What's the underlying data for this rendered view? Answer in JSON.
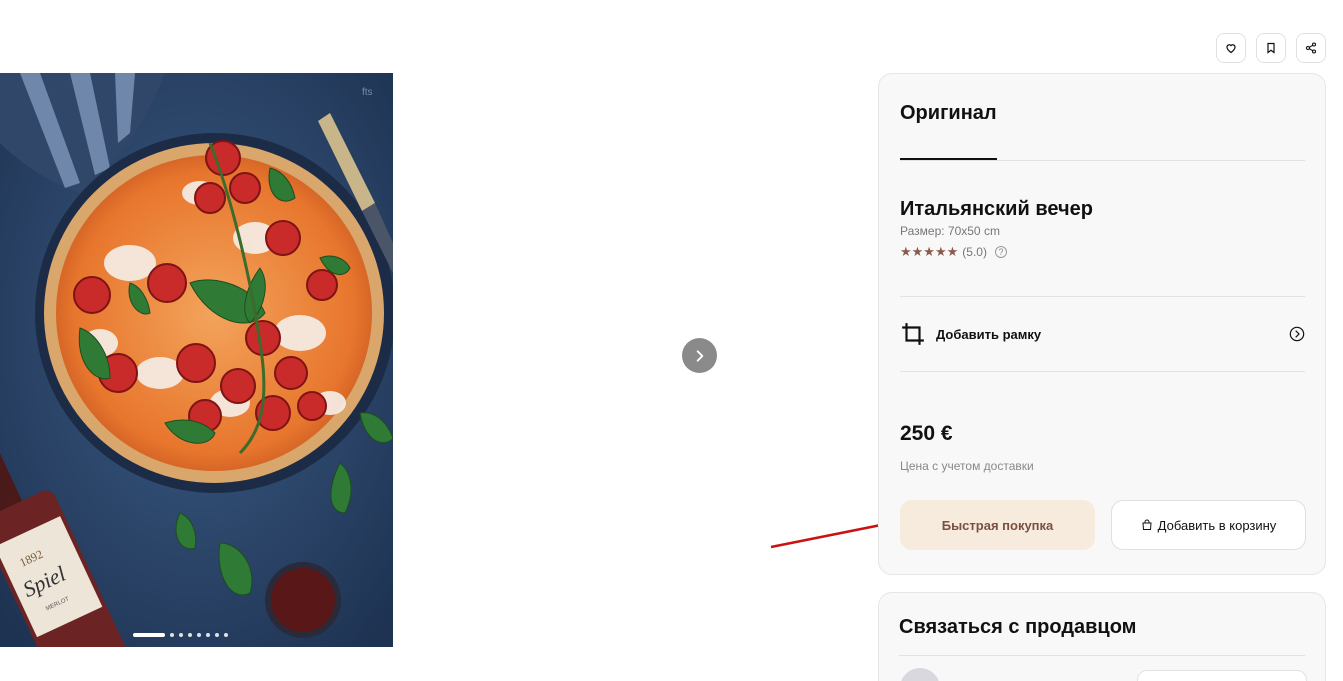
{
  "header": {
    "favorite_icon": "heart-icon",
    "bookmark_icon": "bookmark-icon",
    "share_icon": "share-icon"
  },
  "gallery": {
    "slide_count": 8,
    "active_index": 0,
    "next_icon": "chevron-right-icon"
  },
  "product": {
    "tab_label": "Оригинал",
    "title": "Итальянский вечер",
    "size_text": "Размер: 70x50 cm",
    "stars": "★★★★★",
    "rating_text": "(5.0)",
    "rating_help": "?",
    "frame_label": "Добавить рамку",
    "frame_icon": "crop-icon",
    "frame_chevron_icon": "chevron-right-circle-icon",
    "price": "250 €",
    "price_note": "Цена с учетом доставки",
    "quick_buy_label": "Быстрая покупка",
    "add_to_cart_label": "Добавить в корзину",
    "cart_icon": "shopping-bag-icon"
  },
  "seller": {
    "title": "Связаться с продавцом"
  },
  "colors": {
    "accent_bg": "#f6ebdd",
    "accent_text": "#7a5042",
    "annotation_arrow": "#cc1111"
  }
}
